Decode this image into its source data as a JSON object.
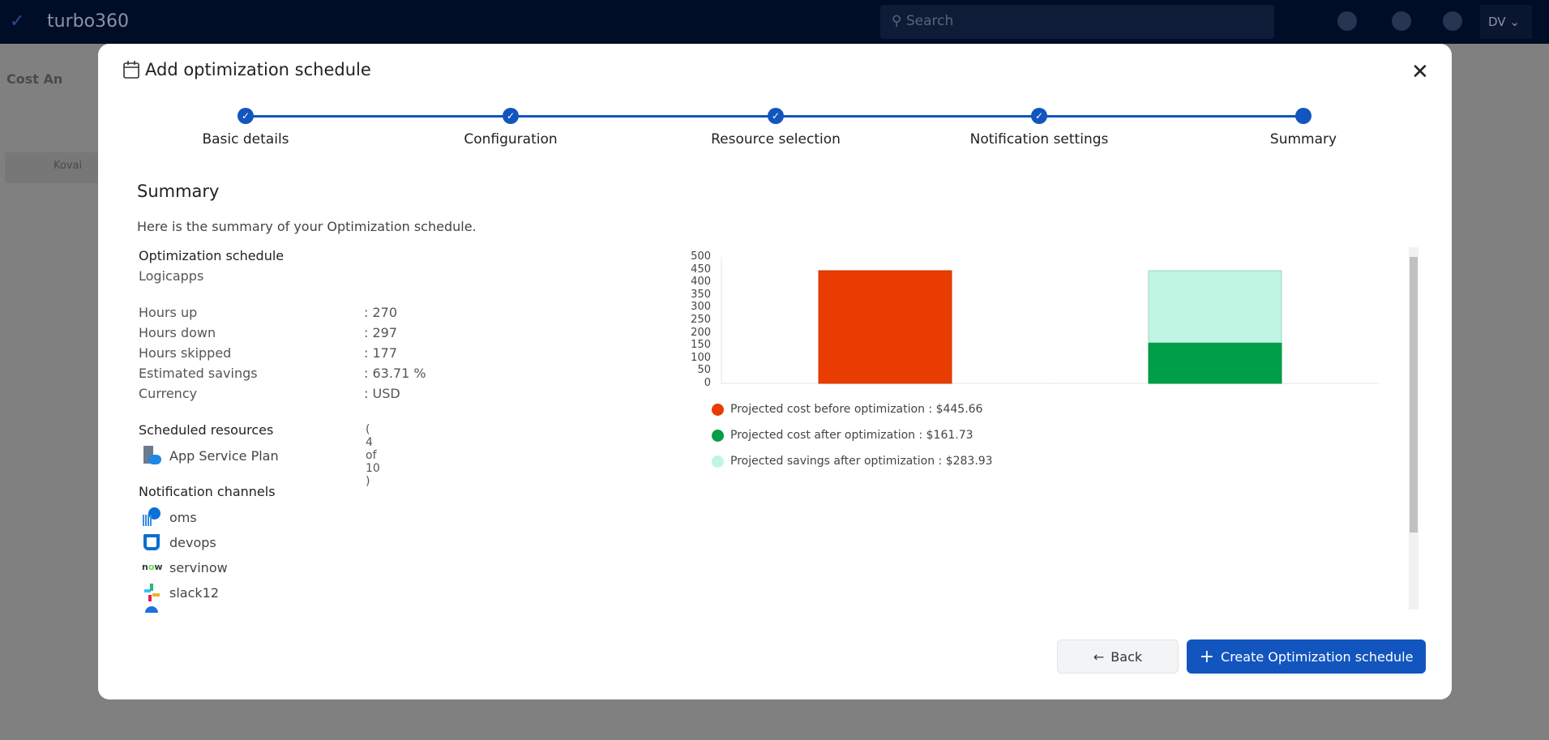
{
  "app": {
    "brand": "turbo360",
    "search_placeholder": "Search",
    "user_initials": "DV"
  },
  "background": {
    "page_title": "Cost An",
    "tree_item": "Kovai"
  },
  "modal": {
    "title": "Add optimization schedule",
    "steps": [
      {
        "label": "Basic details",
        "status": "complete"
      },
      {
        "label": "Configuration",
        "status": "complete"
      },
      {
        "label": "Resource selection",
        "status": "complete"
      },
      {
        "label": "Notification settings",
        "status": "complete"
      },
      {
        "label": "Summary",
        "status": "current"
      }
    ],
    "summary_heading": "Summary",
    "intro": "Here is the summary of your Optimization schedule.",
    "schedule_label": "Optimization schedule",
    "schedule_name": "Logicapps",
    "details": [
      {
        "label": "Hours up",
        "value": ": 270"
      },
      {
        "label": "Hours down",
        "value": ": 297"
      },
      {
        "label": "Hours skipped",
        "value": ": 177"
      },
      {
        "label": "Estimated savings",
        "value": ": 63.71 %"
      },
      {
        "label": "Currency",
        "value": ": USD"
      }
    ],
    "resources_heading": "Scheduled resources",
    "resources": [
      {
        "name": "App Service Plan",
        "count": "( 4 of 10 )",
        "icon": "app-service-plan-icon"
      }
    ],
    "channels_heading": "Notification channels",
    "channels": [
      {
        "name": "oms",
        "icon": "oms-icon"
      },
      {
        "name": "devops",
        "icon": "azure-devops-icon"
      },
      {
        "name": "servinow",
        "icon": "servicenow-icon"
      },
      {
        "name": "slack12",
        "icon": "slack-icon"
      }
    ],
    "back_label": "Back",
    "create_label": "Create Optimization schedule"
  },
  "chart_data": {
    "type": "bar",
    "stacked": true,
    "ylim": [
      0,
      500
    ],
    "yticks": [
      0,
      50,
      100,
      150,
      200,
      250,
      300,
      350,
      400,
      450,
      500
    ],
    "categories": [
      "",
      ""
    ],
    "series": [
      {
        "name": "Projected cost before optimization : $445.66",
        "values": [
          445.66,
          0
        ],
        "color": "#e83c00"
      },
      {
        "name": "Projected cost after optimization : $161.73",
        "values": [
          0,
          161.73
        ],
        "color": "#009e49"
      },
      {
        "name": "Projected savings after optimization : $283.93",
        "values": [
          0,
          283.93
        ],
        "color": "#c0f5e3"
      }
    ],
    "legend": "bottom-left"
  }
}
